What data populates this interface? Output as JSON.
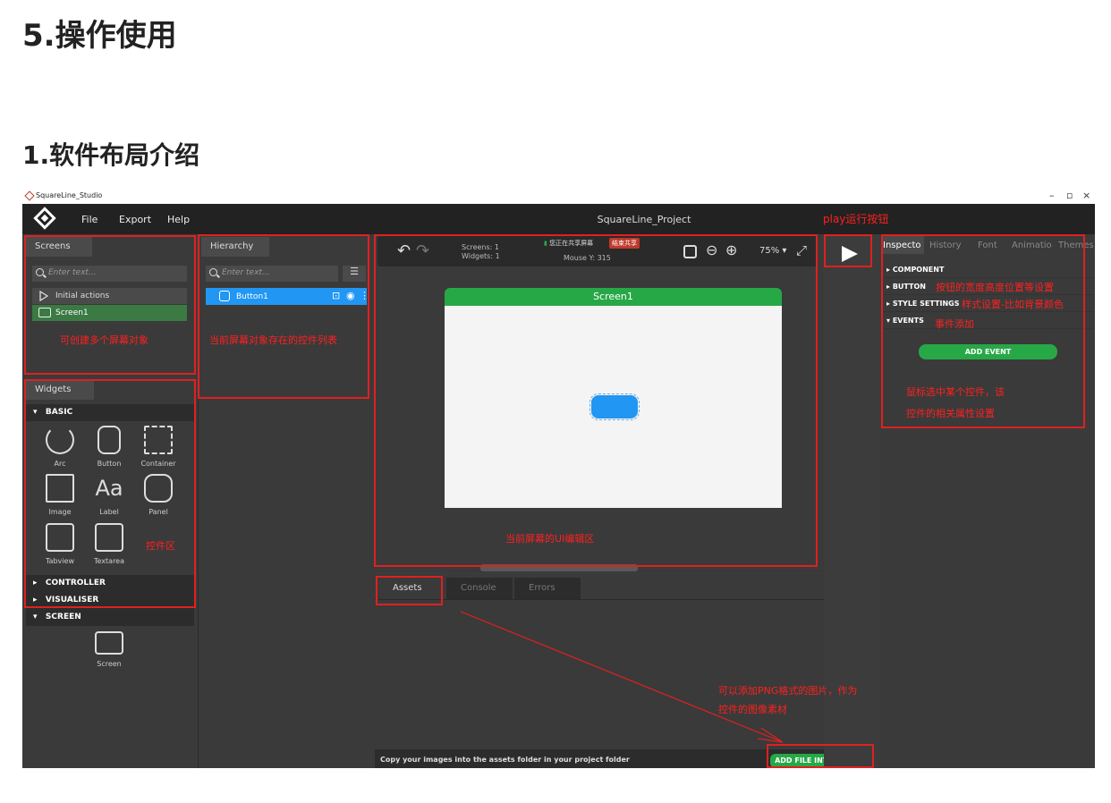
{
  "doc": {
    "heading1": "5.操作使用",
    "heading2": "1.软件布局介绍"
  },
  "window": {
    "title": "SquareLine_Studio",
    "controls": {
      "minimize": "–",
      "restore": "▫",
      "close": "×"
    }
  },
  "menu": {
    "items": [
      "File",
      "Export",
      "Help"
    ],
    "project_title": "SquareLine_Project"
  },
  "screens_panel": {
    "tab": "Screens",
    "search_placeholder": "Enter text...",
    "items": [
      "Initial actions",
      "Screen1"
    ]
  },
  "hierarchy_panel": {
    "tab": "Hierarchy",
    "search_placeholder": "Enter text...",
    "item": "Button1"
  },
  "widgets_panel": {
    "tab": "Widgets",
    "sections": {
      "basic": "BASIC",
      "controller": "CONTROLLER",
      "visualiser": "VISUALISER",
      "screen": "SCREEN"
    },
    "basic_widgets": [
      "Arc",
      "Button",
      "Container",
      "Image",
      "Label",
      "Panel",
      "Tabview",
      "Textarea"
    ],
    "screen_widgets": [
      "Screen"
    ]
  },
  "canvas": {
    "screens_label": "Screens:",
    "screens_count": "1",
    "widgets_label": "Widgets:",
    "widgets_count": "1",
    "share_text": "您正在共享屏幕",
    "share_stop": "结束共享",
    "mouse_label": "Mouse Y:",
    "mouse_value": "315",
    "zoom": "75%",
    "screen_title": "Screen1"
  },
  "bottom_panel": {
    "tabs": [
      "Assets",
      "Console",
      "Errors"
    ],
    "footer_text": "Copy your images into the assets folder in your project folder",
    "add_button": "ADD FILE INTO ASSETS"
  },
  "inspector": {
    "tabs": [
      "Inspecto",
      "History",
      "Font",
      "Animatio",
      "Themes"
    ],
    "rows": [
      "COMPONENT",
      "BUTTON",
      "STYLE SETTINGS",
      "EVENTS"
    ],
    "add_event": "ADD EVENT"
  },
  "annotations": {
    "screens": "可创建多个屏幕对象",
    "hierarchy": "当前屏幕对象存在的控件列表",
    "widgets": "控件区",
    "canvas": "当前屏幕的UI编辑区",
    "play": "play运行按钮",
    "button_row": "按钮的宽度高度位置等设置",
    "style_row": "样式设置-比如背景颜色",
    "events_row": "事件添加",
    "inspector_line1": "鼠标选中某个控件，该",
    "inspector_line2": "控件的相关属性设置",
    "assets_line1": "可以添加PNG格式的图片，作为",
    "assets_line2": "控件的图像素材"
  },
  "colors": {
    "accent_green": "#27a847",
    "select_blue": "#2196f3",
    "annotation_red": "#e02020"
  }
}
